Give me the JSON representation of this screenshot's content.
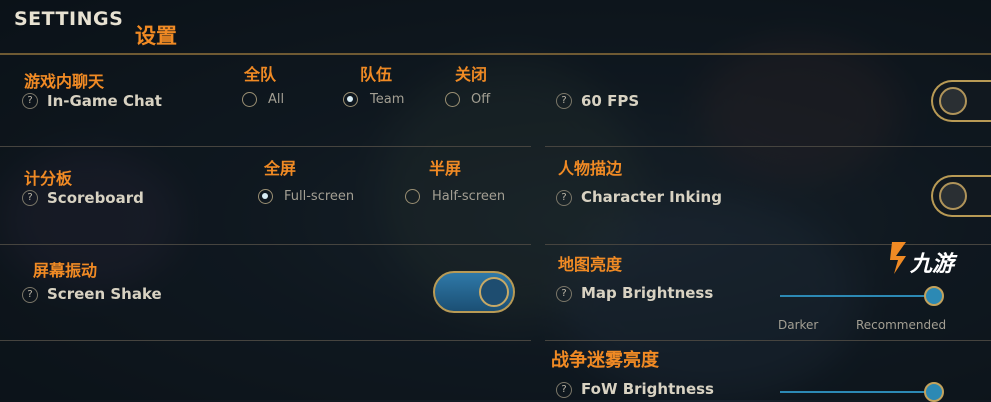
{
  "header": {
    "title": "SETTINGS",
    "title_cn": "设置"
  },
  "chat": {
    "label_cn": "游戏内聊天",
    "label": "In-Game Chat",
    "options": [
      {
        "cn": "全队",
        "label": "All",
        "selected": false
      },
      {
        "cn": "队伍",
        "label": "Team",
        "selected": true
      },
      {
        "cn": "关闭",
        "label": "Off",
        "selected": false
      }
    ]
  },
  "fps": {
    "label": "60 FPS"
  },
  "scoreboard": {
    "label_cn": "计分板",
    "label": "Scoreboard",
    "options": [
      {
        "cn": "全屏",
        "label": "Full-screen",
        "selected": true
      },
      {
        "cn": "半屏",
        "label": "Half-screen",
        "selected": false
      }
    ]
  },
  "inking": {
    "label_cn": "人物描边",
    "label": "Character Inking"
  },
  "shake": {
    "label_cn": "屏幕振动",
    "label": "Screen Shake",
    "enabled": true
  },
  "map_brightness": {
    "label_cn": "地图亮度",
    "label": "Map Brightness",
    "min_label": "Darker",
    "max_label": "Recommended",
    "value": 1.0
  },
  "fow_brightness": {
    "label_cn": "战争迷雾亮度",
    "label": "FoW Brightness",
    "value": 1.0
  },
  "help_glyph": "?",
  "watermark": {
    "text": "九游"
  },
  "colors": {
    "accent": "#f08a24",
    "toggle_on": "#2f79a8",
    "gold": "#b89a55"
  }
}
